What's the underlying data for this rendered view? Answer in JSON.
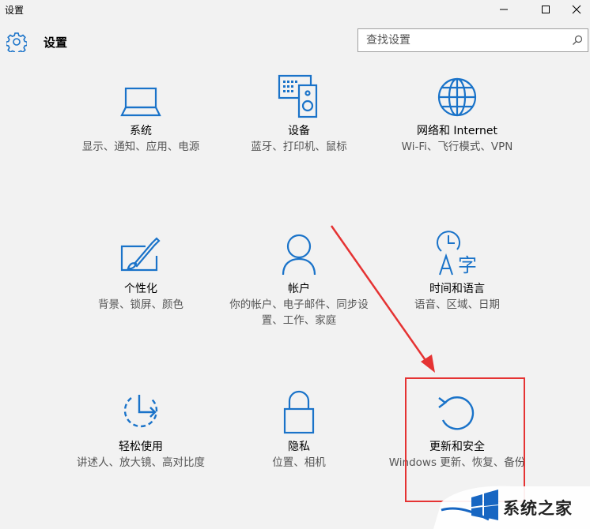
{
  "window": {
    "title": "设置"
  },
  "header": {
    "title": "设置"
  },
  "search": {
    "placeholder": "查找设置"
  },
  "accent_color": "#1a73c9",
  "tiles": [
    {
      "icon": "laptop-icon",
      "name": "系统",
      "desc": "显示、通知、应用、电源"
    },
    {
      "icon": "devices-icon",
      "name": "设备",
      "desc": "蓝牙、打印机、鼠标"
    },
    {
      "icon": "globe-icon",
      "name": "网络和 Internet",
      "desc": "Wi-Fi、飞行模式、VPN"
    },
    {
      "icon": "personalization-icon",
      "name": "个性化",
      "desc": "背景、锁屏、颜色"
    },
    {
      "icon": "person-icon",
      "name": "帐户",
      "desc": "你的帐户、电子邮件、同步设置、工作、家庭"
    },
    {
      "icon": "time-language-icon",
      "name": "时间和语言",
      "desc": "语音、区域、日期"
    },
    {
      "icon": "ease-of-access-icon",
      "name": "轻松使用",
      "desc": "讲述人、放大镜、高对比度"
    },
    {
      "icon": "lock-icon",
      "name": "隐私",
      "desc": "位置、相机"
    },
    {
      "icon": "update-icon",
      "name": "更新和安全",
      "desc": "Windows 更新、恢复、备份"
    }
  ],
  "watermark": {
    "text": "系统之家"
  }
}
